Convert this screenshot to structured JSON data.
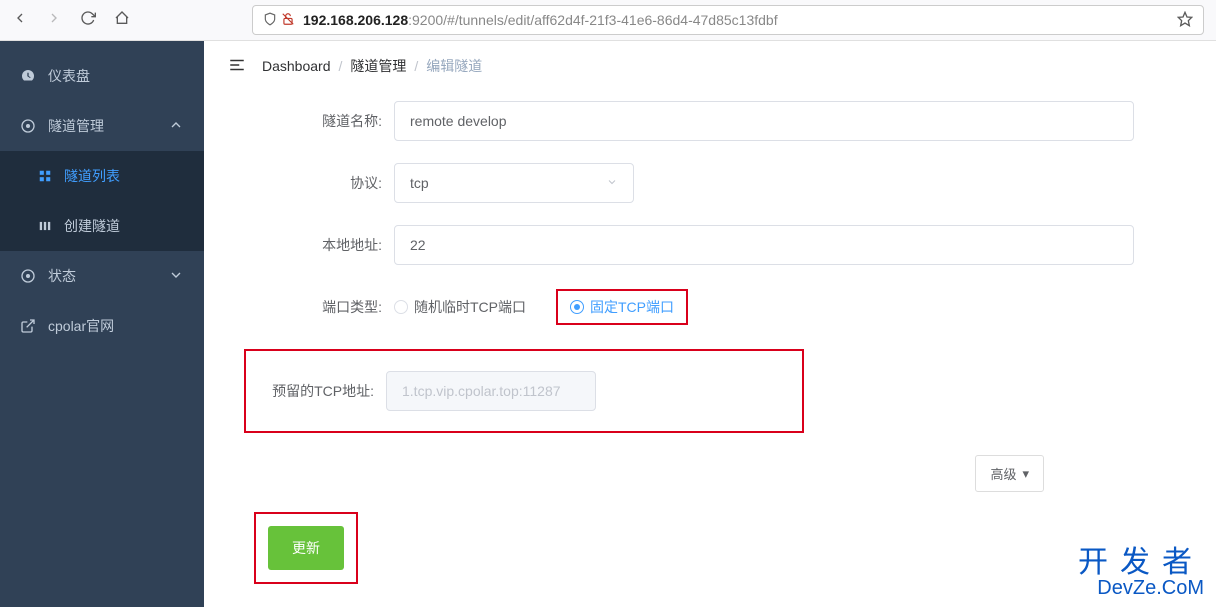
{
  "browser": {
    "url_host": "192.168.206.128",
    "url_rest": ":9200/#/tunnels/edit/aff62d4f-21f3-41e6-86d4-47d85c13fdbf"
  },
  "sidebar": {
    "dashboard": "仪表盘",
    "tunnel_mgmt": "隧道管理",
    "tunnel_list": "隧道列表",
    "tunnel_create": "创建隧道",
    "status": "状态",
    "cpolar_site": "cpolar官网"
  },
  "breadcrumb": {
    "dashboard": "Dashboard",
    "tunnel_mgmt": "隧道管理",
    "edit_tunnel": "编辑隧道"
  },
  "form": {
    "name_label": "隧道名称:",
    "name_value": "remote develop",
    "proto_label": "协议:",
    "proto_value": "tcp",
    "local_addr_label": "本地地址:",
    "local_addr_value": "22",
    "port_type_label": "端口类型:",
    "port_type_random": "随机临时TCP端口",
    "port_type_fixed": "固定TCP端口",
    "reserved_tcp_label": "预留的TCP地址:",
    "reserved_tcp_value": "1.tcp.vip.cpolar.top:11287",
    "advanced": "高级",
    "submit": "更新"
  },
  "watermark": {
    "cn": "开发者",
    "en": "DevZe.CoM"
  }
}
